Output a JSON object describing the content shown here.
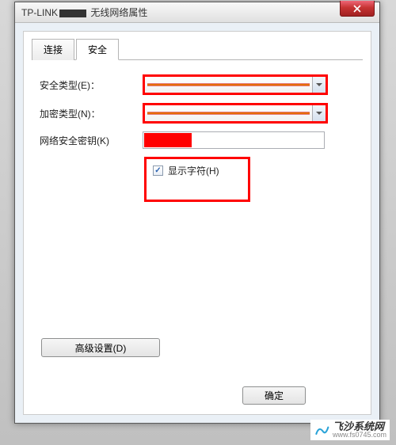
{
  "window": {
    "title_prefix": "TP-LINK",
    "title_suffix": " 无线网络属性"
  },
  "tabs": {
    "connect": "连接",
    "security": "安全"
  },
  "labels": {
    "security_type": "安全类型(E)：",
    "encryption_type": "加密类型(N)：",
    "network_key": "网络安全密钥(K)",
    "show_chars": "显示字符(H)"
  },
  "buttons": {
    "advanced": "高级设置(D)",
    "ok": "确定"
  },
  "watermark": {
    "name": "飞沙系统网",
    "url": "www.fs0745.com"
  }
}
